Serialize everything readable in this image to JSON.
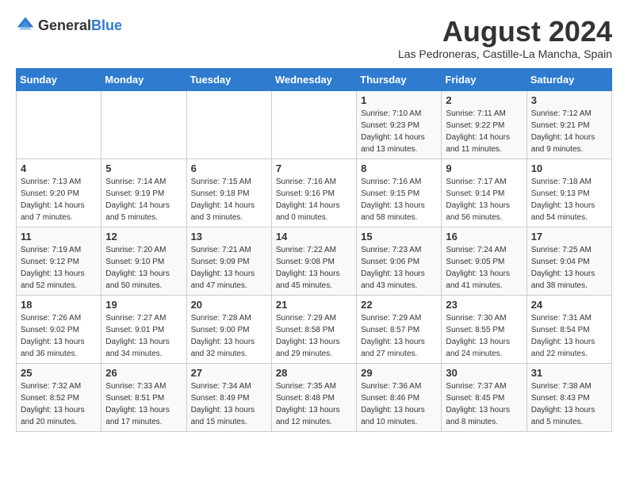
{
  "header": {
    "logo_general": "General",
    "logo_blue": "Blue",
    "month_year": "August 2024",
    "location": "Las Pedroneras, Castille-La Mancha, Spain"
  },
  "days_of_week": [
    "Sunday",
    "Monday",
    "Tuesday",
    "Wednesday",
    "Thursday",
    "Friday",
    "Saturday"
  ],
  "weeks": [
    [
      {
        "day": "",
        "info": ""
      },
      {
        "day": "",
        "info": ""
      },
      {
        "day": "",
        "info": ""
      },
      {
        "day": "",
        "info": ""
      },
      {
        "day": "1",
        "info": "Sunrise: 7:10 AM\nSunset: 9:23 PM\nDaylight: 14 hours\nand 13 minutes."
      },
      {
        "day": "2",
        "info": "Sunrise: 7:11 AM\nSunset: 9:22 PM\nDaylight: 14 hours\nand 11 minutes."
      },
      {
        "day": "3",
        "info": "Sunrise: 7:12 AM\nSunset: 9:21 PM\nDaylight: 14 hours\nand 9 minutes."
      }
    ],
    [
      {
        "day": "4",
        "info": "Sunrise: 7:13 AM\nSunset: 9:20 PM\nDaylight: 14 hours\nand 7 minutes."
      },
      {
        "day": "5",
        "info": "Sunrise: 7:14 AM\nSunset: 9:19 PM\nDaylight: 14 hours\nand 5 minutes."
      },
      {
        "day": "6",
        "info": "Sunrise: 7:15 AM\nSunset: 9:18 PM\nDaylight: 14 hours\nand 3 minutes."
      },
      {
        "day": "7",
        "info": "Sunrise: 7:16 AM\nSunset: 9:16 PM\nDaylight: 14 hours\nand 0 minutes."
      },
      {
        "day": "8",
        "info": "Sunrise: 7:16 AM\nSunset: 9:15 PM\nDaylight: 13 hours\nand 58 minutes."
      },
      {
        "day": "9",
        "info": "Sunrise: 7:17 AM\nSunset: 9:14 PM\nDaylight: 13 hours\nand 56 minutes."
      },
      {
        "day": "10",
        "info": "Sunrise: 7:18 AM\nSunset: 9:13 PM\nDaylight: 13 hours\nand 54 minutes."
      }
    ],
    [
      {
        "day": "11",
        "info": "Sunrise: 7:19 AM\nSunset: 9:12 PM\nDaylight: 13 hours\nand 52 minutes."
      },
      {
        "day": "12",
        "info": "Sunrise: 7:20 AM\nSunset: 9:10 PM\nDaylight: 13 hours\nand 50 minutes."
      },
      {
        "day": "13",
        "info": "Sunrise: 7:21 AM\nSunset: 9:09 PM\nDaylight: 13 hours\nand 47 minutes."
      },
      {
        "day": "14",
        "info": "Sunrise: 7:22 AM\nSunset: 9:08 PM\nDaylight: 13 hours\nand 45 minutes."
      },
      {
        "day": "15",
        "info": "Sunrise: 7:23 AM\nSunset: 9:06 PM\nDaylight: 13 hours\nand 43 minutes."
      },
      {
        "day": "16",
        "info": "Sunrise: 7:24 AM\nSunset: 9:05 PM\nDaylight: 13 hours\nand 41 minutes."
      },
      {
        "day": "17",
        "info": "Sunrise: 7:25 AM\nSunset: 9:04 PM\nDaylight: 13 hours\nand 38 minutes."
      }
    ],
    [
      {
        "day": "18",
        "info": "Sunrise: 7:26 AM\nSunset: 9:02 PM\nDaylight: 13 hours\nand 36 minutes."
      },
      {
        "day": "19",
        "info": "Sunrise: 7:27 AM\nSunset: 9:01 PM\nDaylight: 13 hours\nand 34 minutes."
      },
      {
        "day": "20",
        "info": "Sunrise: 7:28 AM\nSunset: 9:00 PM\nDaylight: 13 hours\nand 32 minutes."
      },
      {
        "day": "21",
        "info": "Sunrise: 7:29 AM\nSunset: 8:58 PM\nDaylight: 13 hours\nand 29 minutes."
      },
      {
        "day": "22",
        "info": "Sunrise: 7:29 AM\nSunset: 8:57 PM\nDaylight: 13 hours\nand 27 minutes."
      },
      {
        "day": "23",
        "info": "Sunrise: 7:30 AM\nSunset: 8:55 PM\nDaylight: 13 hours\nand 24 minutes."
      },
      {
        "day": "24",
        "info": "Sunrise: 7:31 AM\nSunset: 8:54 PM\nDaylight: 13 hours\nand 22 minutes."
      }
    ],
    [
      {
        "day": "25",
        "info": "Sunrise: 7:32 AM\nSunset: 8:52 PM\nDaylight: 13 hours\nand 20 minutes."
      },
      {
        "day": "26",
        "info": "Sunrise: 7:33 AM\nSunset: 8:51 PM\nDaylight: 13 hours\nand 17 minutes."
      },
      {
        "day": "27",
        "info": "Sunrise: 7:34 AM\nSunset: 8:49 PM\nDaylight: 13 hours\nand 15 minutes."
      },
      {
        "day": "28",
        "info": "Sunrise: 7:35 AM\nSunset: 8:48 PM\nDaylight: 13 hours\nand 12 minutes."
      },
      {
        "day": "29",
        "info": "Sunrise: 7:36 AM\nSunset: 8:46 PM\nDaylight: 13 hours\nand 10 minutes."
      },
      {
        "day": "30",
        "info": "Sunrise: 7:37 AM\nSunset: 8:45 PM\nDaylight: 13 hours\nand 8 minutes."
      },
      {
        "day": "31",
        "info": "Sunrise: 7:38 AM\nSunset: 8:43 PM\nDaylight: 13 hours\nand 5 minutes."
      }
    ]
  ]
}
